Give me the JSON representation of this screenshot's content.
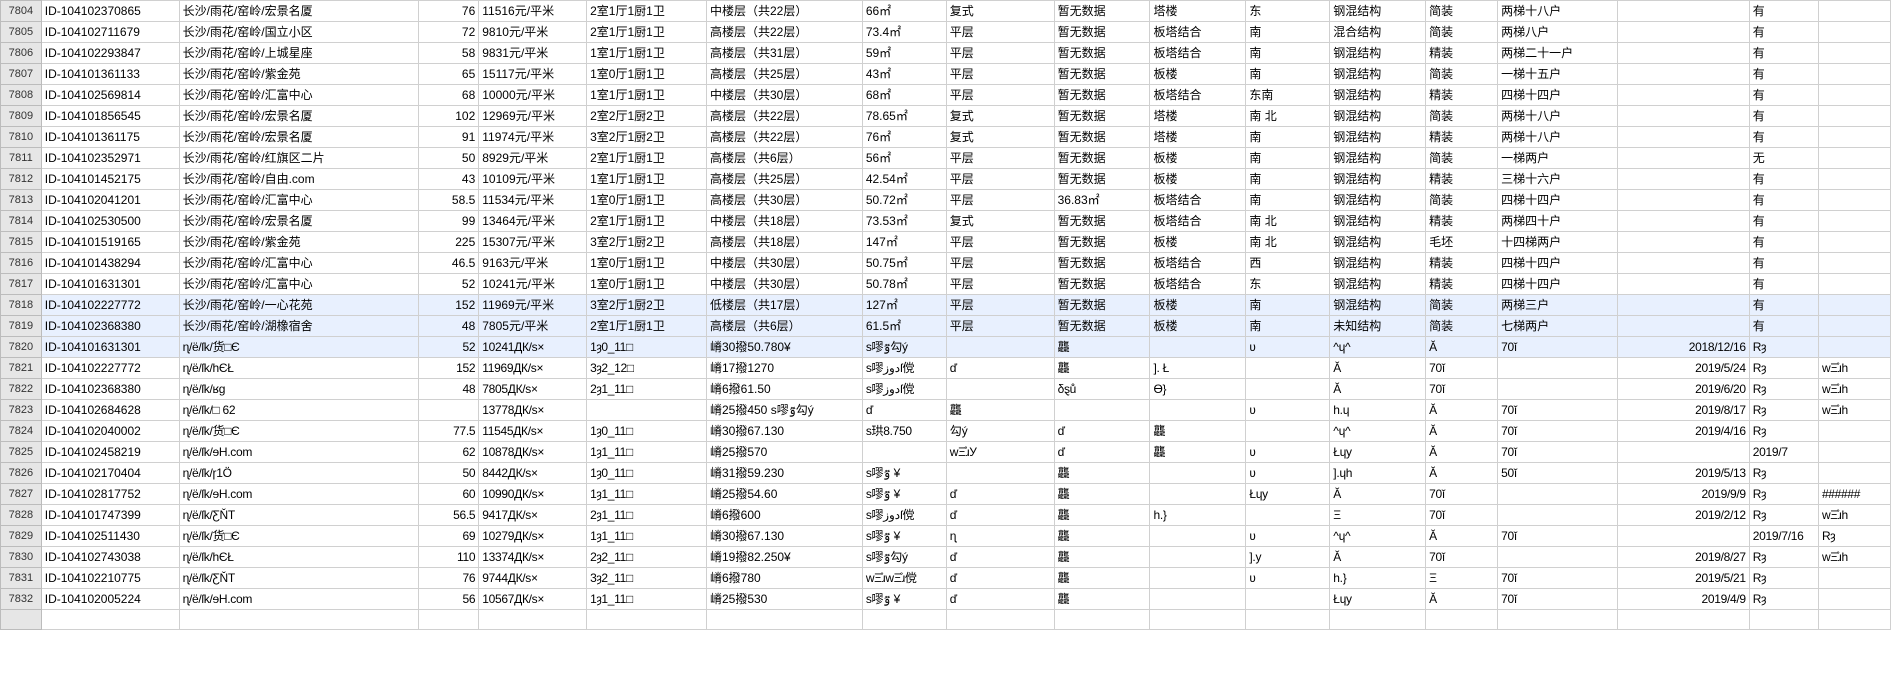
{
  "rows": [
    {
      "n": "7804",
      "c": [
        "ID-104102370865",
        "长沙/雨花/窑岭/宏景名厦",
        "76",
        "11516元/平米",
        "2室1厅1厨1卫",
        "中楼层（共22层）",
        "66㎡",
        "复式",
        "暂无数据",
        "塔楼",
        "东",
        "钢混结构",
        "简装",
        "两梯十八户",
        "",
        "有",
        ""
      ]
    },
    {
      "n": "7805",
      "c": [
        "ID-104102711679",
        "长沙/雨花/窑岭/国立小区",
        "72",
        "9810元/平米",
        "2室1厅1厨1卫",
        "高楼层（共22层）",
        "73.4㎡",
        "平层",
        "暂无数据",
        "板塔结合",
        "南",
        "混合结构",
        "简装",
        "两梯八户",
        "",
        "有",
        ""
      ]
    },
    {
      "n": "7806",
      "c": [
        "ID-104102293847",
        "长沙/雨花/窑岭/上城星座",
        "58",
        "9831元/平米",
        "1室1厅1厨1卫",
        "高楼层（共31层）",
        "59㎡",
        "平层",
        "暂无数据",
        "板塔结合",
        "南",
        "钢混结构",
        "精装",
        "两梯二十一户",
        "",
        "有",
        ""
      ]
    },
    {
      "n": "7807",
      "c": [
        "ID-104101361133",
        "长沙/雨花/窑岭/紫金苑",
        "65",
        "15117元/平米",
        "1室0厅1厨1卫",
        "高楼层（共25层）",
        "43㎡",
        "平层",
        "暂无数据",
        "板楼",
        "南",
        "钢混结构",
        "简装",
        "一梯十五户",
        "",
        "有",
        ""
      ]
    },
    {
      "n": "7808",
      "c": [
        "ID-104102569814",
        "长沙/雨花/窑岭/汇富中心",
        "68",
        "10000元/平米",
        "1室1厅1厨1卫",
        "中楼层（共30层）",
        "68㎡",
        "平层",
        "暂无数据",
        "板塔结合",
        "东南",
        "钢混结构",
        "精装",
        "四梯十四户",
        "",
        "有",
        ""
      ]
    },
    {
      "n": "7809",
      "c": [
        "ID-104101856545",
        "长沙/雨花/窑岭/宏景名厦",
        "102",
        "12969元/平米",
        "2室2厅1厨2卫",
        "高楼层（共22层）",
        "78.65㎡",
        "复式",
        "暂无数据",
        "塔楼",
        "南 北",
        "钢混结构",
        "简装",
        "两梯十八户",
        "",
        "有",
        ""
      ]
    },
    {
      "n": "7810",
      "c": [
        "ID-104101361175",
        "长沙/雨花/窑岭/宏景名厦",
        "91",
        "11974元/平米",
        "3室2厅1厨2卫",
        "高楼层（共22层）",
        "76㎡",
        "复式",
        "暂无数据",
        "塔楼",
        "南",
        "钢混结构",
        "精装",
        "两梯十八户",
        "",
        "有",
        ""
      ]
    },
    {
      "n": "7811",
      "c": [
        "ID-104102352971",
        "长沙/雨花/窑岭/红旗区二片",
        "50",
        "8929元/平米",
        "2室1厅1厨1卫",
        "高楼层（共6层）",
        "56㎡",
        "平层",
        "暂无数据",
        "板楼",
        "南",
        "钢混结构",
        "简装",
        "一梯两户",
        "",
        "无",
        ""
      ]
    },
    {
      "n": "7812",
      "c": [
        "ID-104101452175",
        "长沙/雨花/窑岭/自由.com",
        "43",
        "10109元/平米",
        "1室1厅1厨1卫",
        "高楼层（共25层）",
        "42.54㎡",
        "平层",
        "暂无数据",
        "板楼",
        "南",
        "钢混结构",
        "精装",
        "三梯十六户",
        "",
        "有",
        ""
      ]
    },
    {
      "n": "7813",
      "c": [
        "ID-104102041201",
        "长沙/雨花/窑岭/汇富中心",
        "58.5",
        "11534元/平米",
        "1室0厅1厨1卫",
        "高楼层（共30层）",
        "50.72㎡",
        "平层",
        "36.83㎡",
        "板塔结合",
        "南",
        "钢混结构",
        "简装",
        "四梯十四户",
        "",
        "有",
        ""
      ]
    },
    {
      "n": "7814",
      "c": [
        "ID-104102530500",
        "长沙/雨花/窑岭/宏景名厦",
        "99",
        "13464元/平米",
        "2室1厅1厨1卫",
        "中楼层（共18层）",
        "73.53㎡",
        "复式",
        "暂无数据",
        "板塔结合",
        "南 北",
        "钢混结构",
        "精装",
        "两梯四十户",
        "",
        "有",
        ""
      ]
    },
    {
      "n": "7815",
      "c": [
        "ID-104101519165",
        "长沙/雨花/窑岭/紫金苑",
        "225",
        "15307元/平米",
        "3室2厅1厨2卫",
        "高楼层（共18层）",
        "147㎡",
        "平层",
        "暂无数据",
        "板楼",
        "南 北",
        "钢混结构",
        "毛坯",
        "十四梯两户",
        "",
        "有",
        ""
      ]
    },
    {
      "n": "7816",
      "c": [
        "ID-104101438294",
        "长沙/雨花/窑岭/汇富中心",
        "46.5",
        "9163元/平米",
        "1室0厅1厨1卫",
        "中楼层（共30层）",
        "50.75㎡",
        "平层",
        "暂无数据",
        "板塔结合",
        "西",
        "钢混结构",
        "精装",
        "四梯十四户",
        "",
        "有",
        ""
      ]
    },
    {
      "n": "7817",
      "c": [
        "ID-104101631301",
        "长沙/雨花/窑岭/汇富中心",
        "52",
        "10241元/平米",
        "1室0厅1厨1卫",
        "中楼层（共30层）",
        "50.78㎡",
        "平层",
        "暂无数据",
        "板塔结合",
        "东",
        "钢混结构",
        "精装",
        "四梯十四户",
        "",
        "有",
        ""
      ]
    },
    {
      "n": "7818",
      "sel": true,
      "c": [
        "ID-104102227772",
        "长沙/雨花/窑岭/一心花苑",
        "152",
        "11969元/平米",
        "3室2厅1厨2卫",
        "低楼层（共17层）",
        "127㎡",
        "平层",
        "暂无数据",
        "板楼",
        "南",
        "钢混结构",
        "简装",
        "两梯三户",
        "",
        "有",
        ""
      ]
    },
    {
      "n": "7819",
      "sel": true,
      "c": [
        "ID-104102368380",
        "长沙/雨花/窑岭/湖橡宿舍",
        "48",
        "7805元/平米",
        "2室1厅1厨1卫",
        "高楼层（共6层）",
        "61.5㎡",
        "平层",
        "暂无数据",
        "板楼",
        "南",
        "未知结构",
        "简装",
        "七梯两户",
        "",
        "有",
        ""
      ]
    },
    {
      "n": "7820",
      "sel": true,
      "c": [
        "ID-104101631301",
        "ɳ/ё/ſk/货□Є",
        "52",
        "10241ДК/s×",
        "1ȝ0_11□",
        "嵴30撥50.780¥",
        "s嘐ٷ勾ý",
        "",
        "龘",
        "",
        "ʋ",
        "^ɥ^",
        "Ă",
        "70ĭ",
        "2018/12/16",
        "Rȝ",
        ""
      ]
    },
    {
      "n": "7821",
      "c": [
        "ID-104102227772",
        "ɳ/ё/ſk/hЄŁ",
        "152",
        "11969ДК/s×",
        "3ȝ2_12□",
        "嵴17撥1270",
        "s嘐دوزſ傥",
        "ď",
        "龘",
        "]. Ł",
        "",
        "Ă",
        "70ĭ",
        "",
        "2019/5/24",
        "Rȝ",
        "wΞ̊ɹh"
      ]
    },
    {
      "n": "7822",
      "c": [
        "ID-104102368380",
        "ɳ/ё/ſk/ʁg",
        "48",
        "7805ДК/s×",
        "2ȝ1_11□",
        "嵴6撥61.50",
        "s嘐دوزſ傥",
        "",
        "δȿů",
        "Ɵ}",
        "",
        "Ă",
        "70ĭ",
        "",
        "2019/6/20",
        "Rȝ",
        "wΞ̊ɹh"
      ]
    },
    {
      "n": "7823",
      "c": [
        "ID-104102684628",
        "ɳ/ё/ſk/□   62",
        "",
        "13778ДК/s×",
        "",
        "嵴25撥450  s嘐ٷ勾ý",
        "ď",
        "龘",
        "",
        "",
        "ʋ",
        "h.ɥ",
        "Ă",
        "70ĭ",
        "2019/8/17",
        "Rȝ",
        "wΞ̊ɹh"
      ]
    },
    {
      "n": "7824",
      "c": [
        "ID-104102040002",
        "ɳ/ё/ſk/货□Є",
        "77.5",
        "11545ДК/s×",
        "1ȝ0_11□",
        "嵴30撥67.130",
        "s珙8.750",
        "勾ý",
        "ď",
        "龘",
        "",
        "^ɥ^",
        "Ă",
        "70ĭ",
        "2019/4/16",
        "Rȝ",
        ""
      ]
    },
    {
      "n": "7825",
      "c": [
        "ID-104102458219",
        "ɳ/ё/ſk/ɘH.com",
        "62",
        "10878ДК/s×",
        "1ȝ1_11□",
        "嵴25撥570",
        "",
        "wΞ̊ɹУ",
        "ď",
        "龘",
        "ʋ",
        "Łɥy",
        "Ă",
        "70ĭ",
        "",
        "2019/7",
        ""
      ]
    },
    {
      "n": "7826",
      "c": [
        "ID-104102170404",
        "ɳ/ё/ſk/ɼ1Ö",
        "50",
        "8442ДК/s×",
        "1ȝ0_11□",
        "嵴31撥59.230",
        "s嘐ٷ ¥",
        "",
        "龘",
        "",
        "ʋ",
        "].ɥh",
        "Ă",
        "50ĭ",
        "2019/5/13",
        "Rȝ",
        ""
      ]
    },
    {
      "n": "7827",
      "c": [
        "ID-104102817752",
        "ɳ/ё/ſk/ɘH.com",
        "60",
        "10990ДК/s×",
        "1ȝ1_11□",
        "嵴25撥54.60",
        "s嘐ٷ ¥",
        "ď",
        "龘",
        "",
        "Łɥy",
        "Ă",
        "70ĭ",
        "",
        "2019/9/9",
        "Rȝ",
        "######"
      ]
    },
    {
      "n": "7828",
      "c": [
        "ID-104101747399",
        "ɳ/ё/ſk/ƸŇT",
        "56.5",
        "9417ДК/s×",
        "2ȝ1_11□",
        "嵴6撥600",
        "s嘐دوزſ傥",
        "ď",
        "龘",
        "h.}",
        "",
        "Ξ",
        "70ĭ",
        "",
        "2019/2/12",
        "Rȝ",
        "wΞ̊ɹh"
      ]
    },
    {
      "n": "7829",
      "c": [
        "ID-104102511430",
        "ɳ/ё/ſk/货□Є",
        "69",
        "10279ДК/s×",
        "1ȝ1_11□",
        "嵴30撥67.130",
        "s嘐ٷ ¥",
        "ɳ",
        "龘",
        "",
        "ʋ",
        "^ɥ^",
        "Ă",
        "70ĭ",
        "",
        "2019/7/16",
        "Rȝ",
        ""
      ]
    },
    {
      "n": "7830",
      "c": [
        "ID-104102743038",
        "ɳ/ё/ſk/hЄŁ",
        "110",
        "13374ДК/s×",
        "2ȝ2_11□",
        "嵴19撥82.250¥",
        "s嘐ٷ勾ý",
        "ď",
        "龘",
        "",
        "].y",
        "Ă",
        "70ĭ",
        "",
        "2019/8/27",
        "Rȝ",
        "wΞ̊ɹh"
      ]
    },
    {
      "n": "7831",
      "c": [
        "ID-104102210775",
        "ɳ/ё/ſk/ƸŇT",
        "76",
        "9744ДК/s×",
        "3ȝ2_11□",
        "嵴6撥780",
        "wΞ̊ɹwΞ̊ɹ傥",
        "ď",
        "龘",
        "",
        "ʋ",
        "h.}",
        "Ξ",
        "70ĭ",
        "2019/5/21",
        "Rȝ",
        ""
      ]
    },
    {
      "n": "7832",
      "c": [
        "ID-104102005224",
        "ɳ/ё/ſk/ɘH.com",
        "56",
        "10567ДК/s×",
        "1ȝ1_11□",
        "嵴25撥530",
        "s嘐ٷ ¥",
        "ď",
        "龘",
        "",
        "",
        "Łɥy",
        "Ă",
        "70ĭ",
        "2019/4/9",
        "Rȝ",
        ""
      ]
    }
  ],
  "colClasses": [
    "c0",
    "c1",
    "c2",
    "c3",
    "c4",
    "c5",
    "c6",
    "c7",
    "c8",
    "c9",
    "c10",
    "c11",
    "c12",
    "c13",
    "c14",
    "c15",
    "c16"
  ]
}
